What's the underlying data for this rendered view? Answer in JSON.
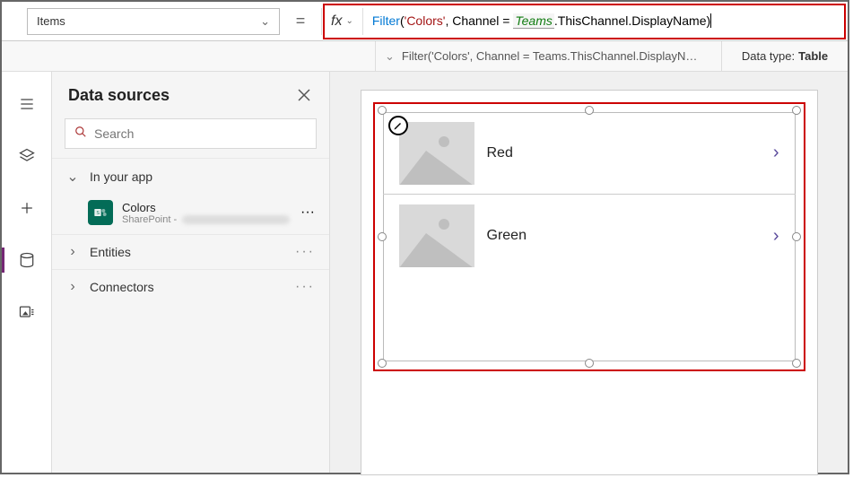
{
  "property_dropdown": {
    "label": "Items"
  },
  "equals": "=",
  "fx_label": "fx",
  "formula": {
    "fn": "Filter",
    "open": "(",
    "arg1": "'Colors'",
    "sep": ", ",
    "lhs": "Channel",
    "eq": " = ",
    "teams": "Teams",
    "rest": ".ThisChannel.DisplayName",
    "close": ")"
  },
  "result_bar": {
    "chevron": "›",
    "text": "Filter('Colors', Channel = Teams.ThisChannel.DisplayN…",
    "datatype_label": "Data type:",
    "datatype_value": "Table"
  },
  "panel": {
    "title": "Data sources",
    "search_placeholder": "Search",
    "sections": {
      "in_your_app": "In your app",
      "entities": "Entities",
      "connectors": "Connectors"
    },
    "datasource": {
      "name": "Colors",
      "subtitle_prefix": "SharePoint -"
    },
    "dots": "···"
  },
  "gallery": {
    "items": [
      {
        "title": "Red"
      },
      {
        "title": "Green"
      }
    ],
    "arrow": "›"
  }
}
